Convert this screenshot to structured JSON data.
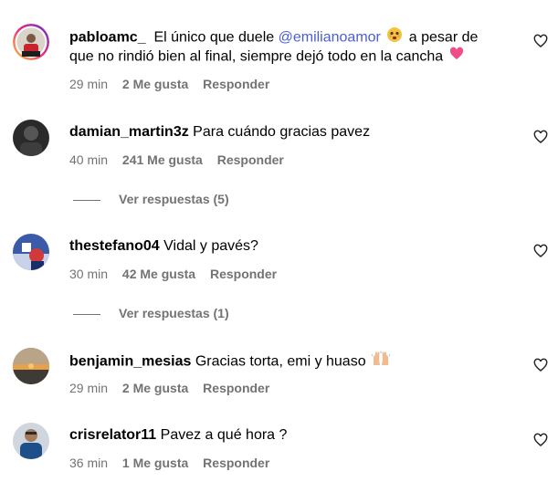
{
  "comments": [
    {
      "username": "pabloamc_",
      "text_before": "El único que duele",
      "mention": "@emilianoamor",
      "text_line1_after": "a pesar de",
      "text_line2": "que no rindió bien al final, siempre dejó todo en la cancha",
      "emoji1": "worried-face-emoji",
      "emoji2": "pink-heart-emoji",
      "time": "29 min",
      "likes": "2 Me gusta",
      "reply": "Responder"
    },
    {
      "username": "damian_martin3z",
      "text": "Para cuándo gracias pavez",
      "time": "40 min",
      "likes": "241 Me gusta",
      "reply": "Responder",
      "view_replies": "Ver respuestas (5)"
    },
    {
      "username": "thestefano04",
      "text": "Vidal y pavés?",
      "time": "30 min",
      "likes": "42 Me gusta",
      "reply": "Responder",
      "view_replies": "Ver respuestas (1)"
    },
    {
      "username": "benjamin_mesias",
      "text": "Gracias torta, emi y huaso",
      "emoji": "raising-hands-emoji",
      "time": "29 min",
      "likes": "2 Me gusta",
      "reply": "Responder"
    },
    {
      "username": "crisrelator11",
      "text": "Pavez a qué hora ?",
      "time": "36 min",
      "likes": "1 Me gusta",
      "reply": "Responder"
    }
  ],
  "colors": {
    "meta": "#737373",
    "mention": "#4a5dd6",
    "heart_icon": "#262626"
  }
}
